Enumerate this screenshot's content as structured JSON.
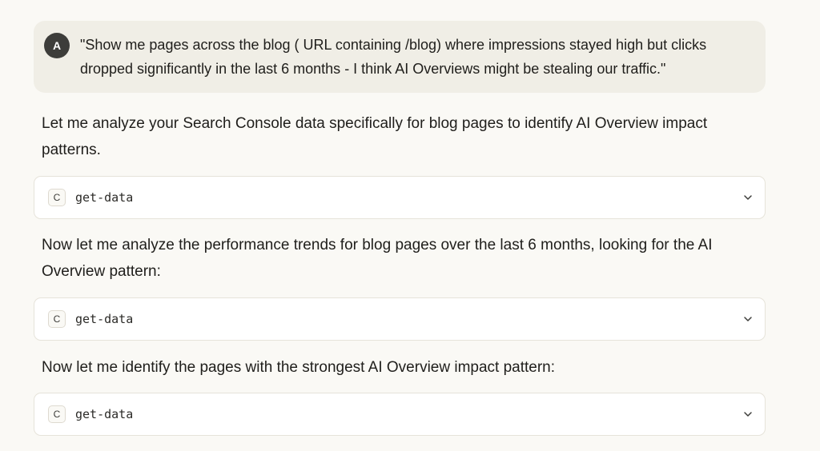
{
  "user_message": {
    "avatar_initial": "A",
    "text": "\"Show me pages across the blog ( URL containing /blog) where impressions stayed high but clicks dropped significantly in the last 6 months - I think AI Overviews might be stealing our traffic.\""
  },
  "assistant": {
    "paragraphs": [
      "Let me analyze your Search Console data specifically for blog pages to identify AI Overview impact patterns.",
      "Now let me analyze the performance trends for blog pages over the last 6 months, looking for the AI Overview pattern:",
      "Now let me identify the pages with the strongest AI Overview impact pattern:"
    ],
    "tool_calls": [
      {
        "icon_letter": "C",
        "name": "get-data",
        "icon": "chevron-down-icon"
      },
      {
        "icon_letter": "C",
        "name": "get-data",
        "icon": "chevron-down-icon"
      },
      {
        "icon_letter": "C",
        "name": "get-data",
        "icon": "chevron-down-icon"
      }
    ]
  },
  "colors": {
    "background": "#faf9f5",
    "user_bubble": "#f0eee6",
    "avatar": "#3d3d3a",
    "card_border": "#e6e3da"
  }
}
